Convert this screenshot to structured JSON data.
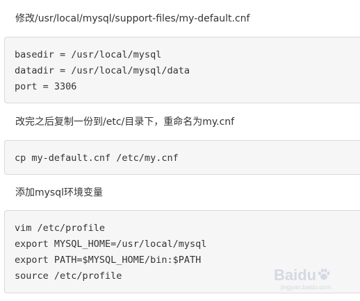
{
  "steps": [
    {
      "instruction": "修改/usr/local/mysql/support-files/my-default.cnf",
      "code": [
        "basedir = /usr/local/mysql",
        "datadir = /usr/local/mysql/data",
        "port = 3306"
      ]
    },
    {
      "instruction": "改完之后复制一份到/etc/目录下，重命名为my.cnf",
      "code": [
        "cp my-default.cnf /etc/my.cnf"
      ]
    },
    {
      "instruction": "添加mysql环境变量",
      "code": [
        "vim /etc/profile",
        "export MYSQL_HOME=/usr/local/mysql",
        "export PATH=$MYSQL_HOME/bin:$PATH",
        "source /etc/profile"
      ]
    }
  ],
  "watermark": {
    "brand": "Baidu",
    "sub": "jingyan.baidu.com"
  }
}
